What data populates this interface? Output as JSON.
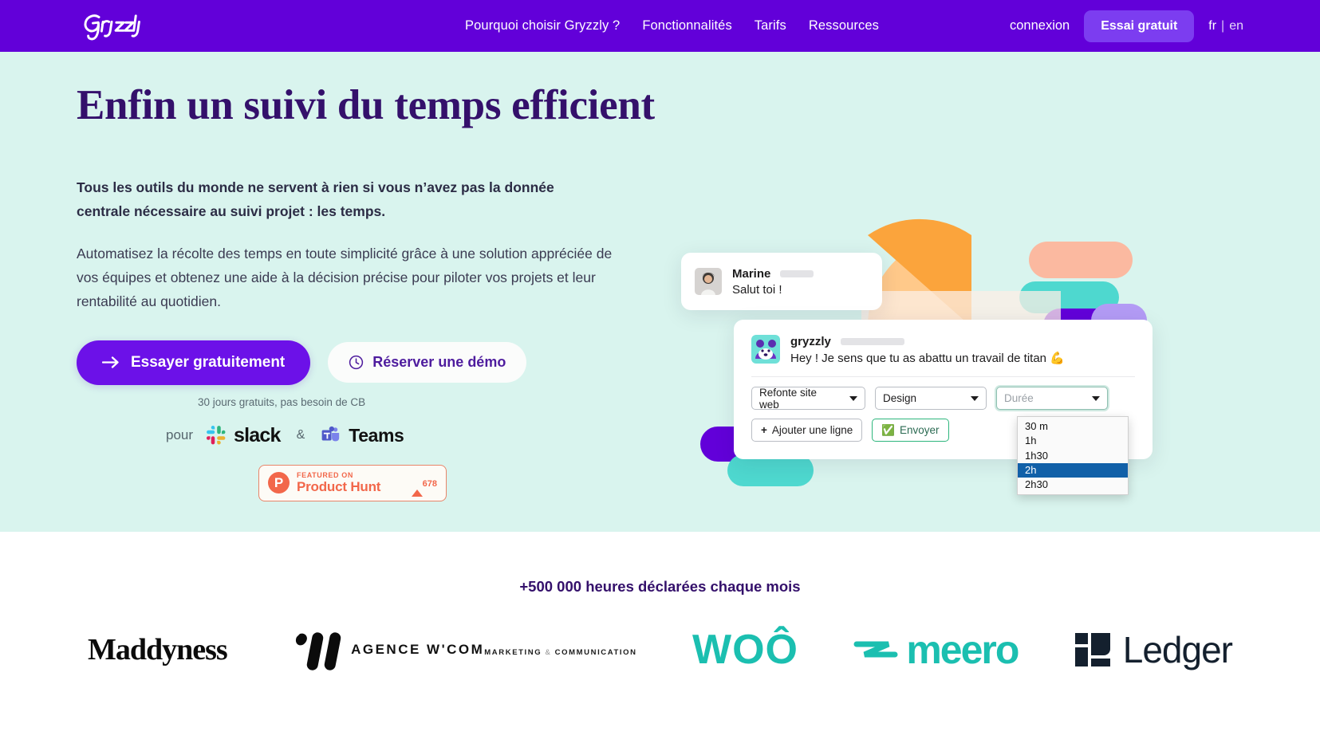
{
  "nav": {
    "logo_text": "Gryzzly",
    "links": [
      {
        "label": "Pourquoi choisir Gryzzly ?"
      },
      {
        "label": "Fonctionnalités"
      },
      {
        "label": "Tarifs"
      },
      {
        "label": "Ressources"
      }
    ],
    "login_label": "connexion",
    "cta_label": "Essai gratuit",
    "lang_active": "fr",
    "lang_separator": "|",
    "lang_inactive": "en",
    "bg_color": "#6200D9",
    "cta_color": "#7c3df0"
  },
  "hero": {
    "headline": "Enfin un suivi du temps efficient",
    "lede": "Tous les outils du monde ne servent à rien si vous n’avez pas la donnée centrale nécessaire au suivi projet : les temps.",
    "body": "Automatisez la récolte des temps en toute simplicité grâce à une solution appréciée de vos équipes et obtenez une aide à la décision précise pour piloter vos projets et leur rentabilité au quotidien.",
    "primary_cta": "Essayer gratuitement",
    "secondary_cta": "Réserver une démo",
    "note": "30 jours gratuits, pas besoin de CB",
    "integrations": {
      "prefix": "pour",
      "slack": "slack",
      "ampersand": "&",
      "teams": "Teams"
    },
    "product_hunt": {
      "featured_label": "FEATURED ON",
      "name": "Product Hunt",
      "votes": "678",
      "accent": "#F2674A"
    },
    "bg_color": "#D9F4EE",
    "headline_color": "#34106B"
  },
  "mockup": {
    "marine": {
      "name": "Marine",
      "message": "Salut toi !"
    },
    "bot": {
      "name": "gryzzly",
      "message": "Hey ! Je sens que tu as abattu un travail de titan 💪"
    },
    "fields": {
      "project_value": "Refonte site web",
      "task_value": "Design",
      "duration_placeholder": "Durée"
    },
    "actions": {
      "add_line": "Ajouter une ligne",
      "add_line_icon": "+",
      "send": "Envoyer",
      "send_icon": "✅"
    },
    "duration_options": [
      {
        "label": "30 m",
        "selected": false
      },
      {
        "label": "1h",
        "selected": false
      },
      {
        "label": "1h30",
        "selected": false
      },
      {
        "label": "2h",
        "selected": true
      },
      {
        "label": "2h30",
        "selected": false
      }
    ]
  },
  "band": {
    "title": "+500 000 heures déclarées chaque mois",
    "logos": [
      {
        "name": "Maddyness"
      },
      {
        "name": "AGENCE W'COM",
        "sub_a": "MARKETING",
        "sub_b": "&",
        "sub_c": "COMMUNICATION"
      },
      {
        "name": "WOÔ"
      },
      {
        "name": "meero"
      },
      {
        "name": "Ledger"
      }
    ]
  }
}
